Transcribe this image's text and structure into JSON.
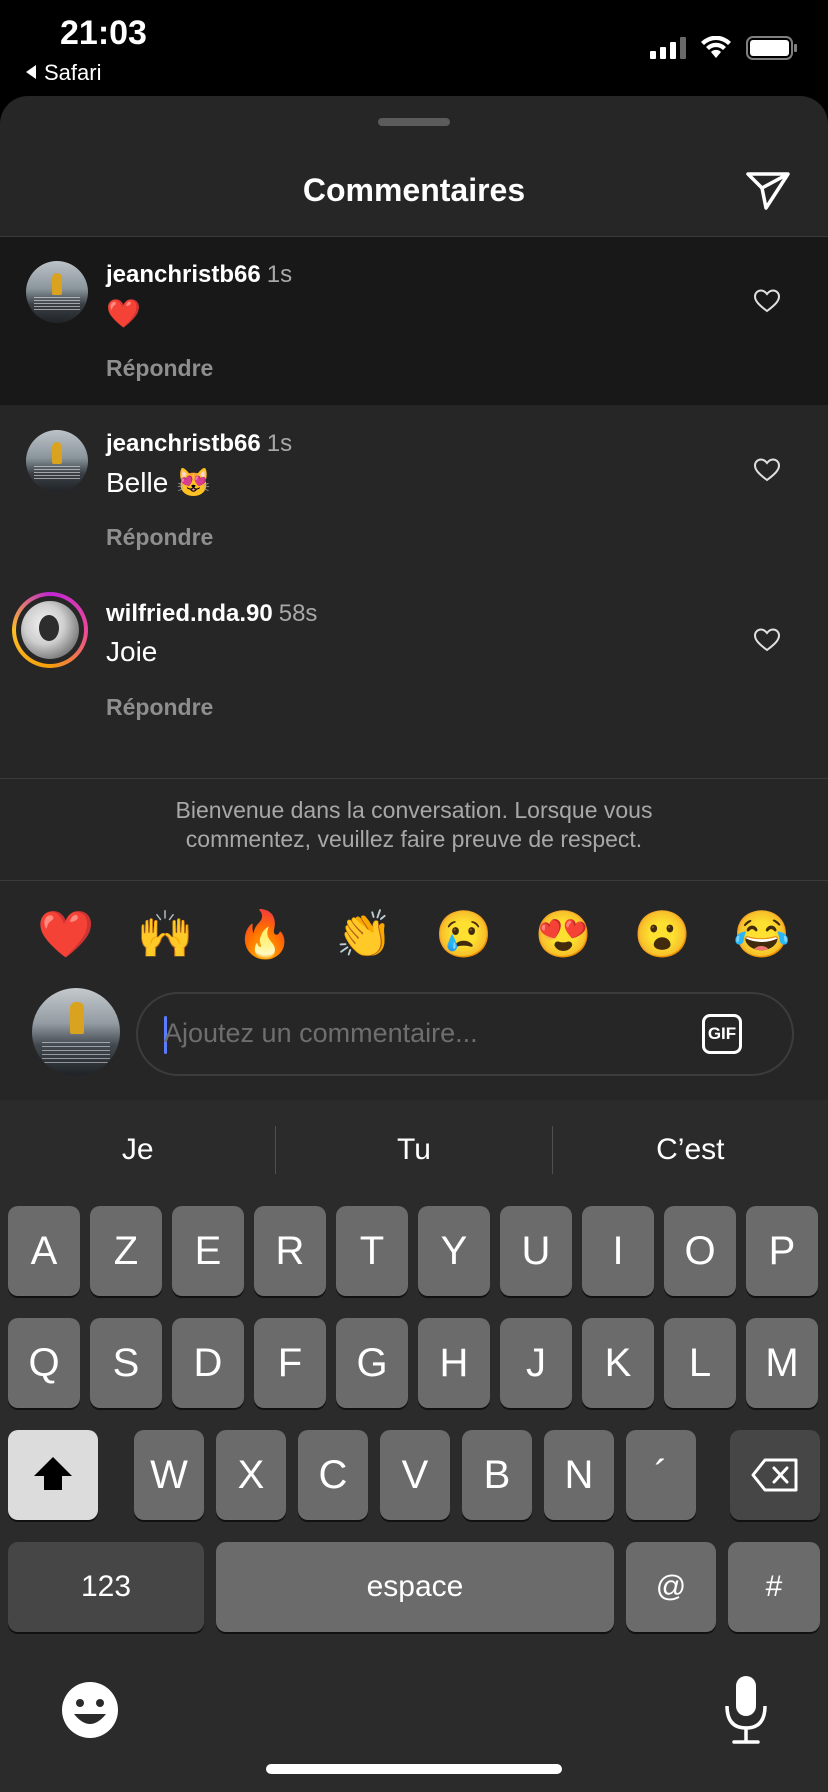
{
  "status_bar": {
    "time": "21:03",
    "back_app": "Safari"
  },
  "sheet": {
    "title": "Commentaires"
  },
  "comments": [
    {
      "username": "jeanchristb66",
      "time": "1s",
      "text": "❤️",
      "reply": "Répondre"
    },
    {
      "username": "jeanchristb66",
      "time": "1s",
      "text": "Belle 😻",
      "reply": "Répondre"
    },
    {
      "username": "wilfried.nda.90",
      "time": "58s",
      "text": "Joie",
      "reply": "Répondre"
    }
  ],
  "welcome": {
    "line1": "Bienvenue dans la conversation. Lorsque vous",
    "line2": "commentez, veuillez faire preuve de respect."
  },
  "reactions": [
    "❤️",
    "🙌",
    "🔥",
    "👏",
    "😢",
    "😍",
    "😮",
    "😂"
  ],
  "composer": {
    "placeholder": "Ajoutez un commentaire...",
    "gif_label": "GIF"
  },
  "keyboard": {
    "suggestions": [
      "Je",
      "Tu",
      "C’est"
    ],
    "row1": [
      "A",
      "Z",
      "E",
      "R",
      "T",
      "Y",
      "U",
      "I",
      "O",
      "P"
    ],
    "row2": [
      "Q",
      "S",
      "D",
      "F",
      "G",
      "H",
      "J",
      "K",
      "L",
      "M"
    ],
    "row3": [
      "W",
      "X",
      "C",
      "V",
      "B",
      "N",
      "´"
    ],
    "numbers_label": "123",
    "space_label": "espace",
    "at_label": "@",
    "hash_label": "#"
  }
}
